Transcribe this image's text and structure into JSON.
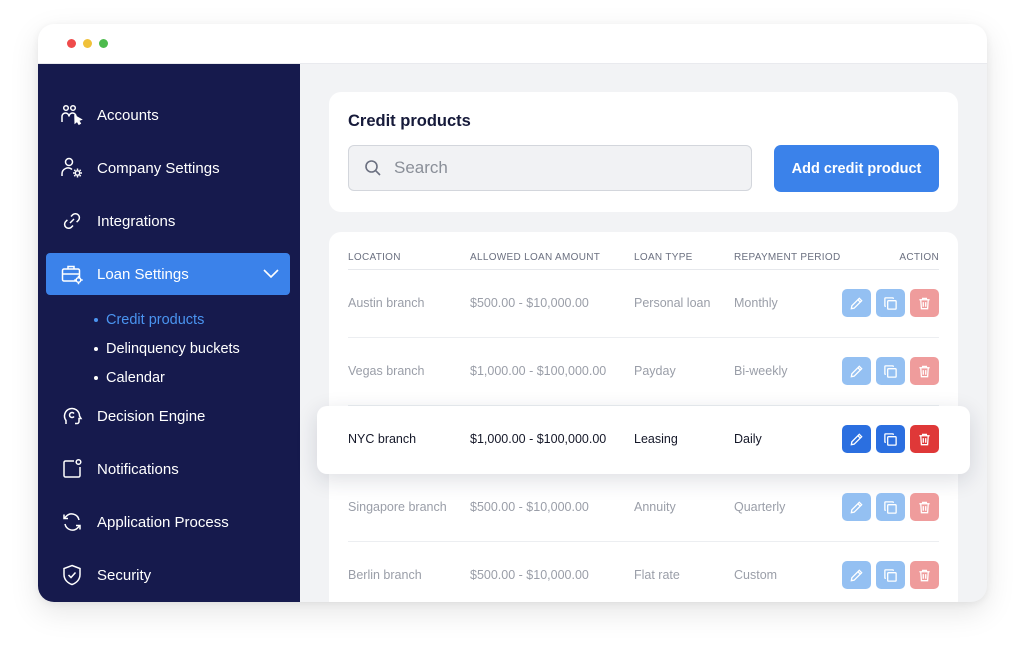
{
  "sidebar": {
    "items": [
      {
        "label": "Accounts",
        "icon": "accounts-icon"
      },
      {
        "label": "Company Settings",
        "icon": "company-settings-icon"
      },
      {
        "label": "Integrations",
        "icon": "integrations-icon"
      },
      {
        "label": "Loan Settings",
        "icon": "loan-settings-icon",
        "active": true
      },
      {
        "label": "Decision Engine",
        "icon": "decision-engine-icon"
      },
      {
        "label": "Notifications",
        "icon": "notifications-icon"
      },
      {
        "label": "Application Process",
        "icon": "application-process-icon"
      },
      {
        "label": "Security",
        "icon": "security-icon"
      }
    ],
    "subitems": [
      {
        "label": "Credit products",
        "active": true
      },
      {
        "label": "Delinquency buckets"
      },
      {
        "label": "Calendar"
      }
    ]
  },
  "header": {
    "title": "Credit products",
    "search_placeholder": "Search",
    "add_button": "Add credit product"
  },
  "table": {
    "columns": [
      "LOCATION",
      "ALLOWED LOAN AMOUNT",
      "LOAN TYPE",
      "REPAYMENT PERIOD",
      "ACTION"
    ],
    "rows": [
      {
        "location": "Austin branch",
        "amount": "$500.00 - $10,000.00",
        "type": "Personal loan",
        "period": "Monthly"
      },
      {
        "location": "Vegas branch",
        "amount": "$1,000.00 - $100,000.00",
        "type": "Payday",
        "period": "Bi-weekly"
      },
      {
        "location": "NYC branch",
        "amount": "$1,000.00 - $100,000.00",
        "type": "Leasing",
        "period": "Daily",
        "highlighted": true
      },
      {
        "location": "Singapore branch",
        "amount": "$500.00 - $10,000.00",
        "type": "Annuity",
        "period": "Quarterly"
      },
      {
        "location": "Berlin branch",
        "amount": "$500.00 - $10,000.00",
        "type": "Flat rate",
        "period": "Custom"
      }
    ]
  },
  "colors": {
    "sidebar_bg": "#161a4d",
    "accent": "#3b82ea",
    "delete": "#df3838"
  }
}
